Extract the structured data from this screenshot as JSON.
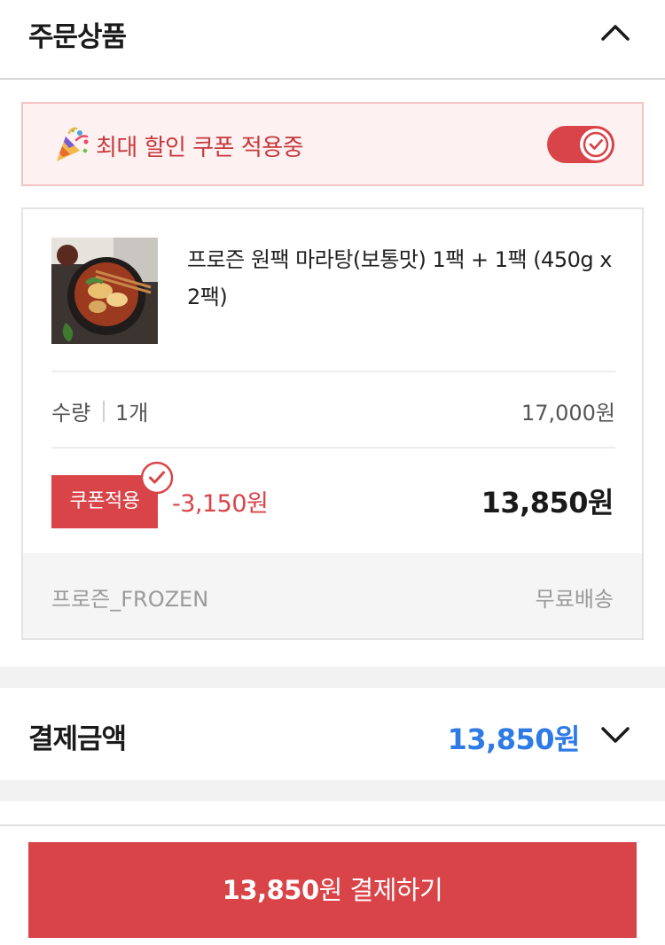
{
  "header": {
    "title": "주문상품",
    "collapse_icon": "chevron-up-icon"
  },
  "coupon_banner": {
    "icon": "party-popper-icon",
    "text": "최대 할인 쿠폰 적용중",
    "toggle_on": true,
    "accent_color": "#d94448"
  },
  "product": {
    "name": "프로즌 원팩 마라탕(보통맛) 1팩 + 1팩 (450g x 2팩)",
    "quantity_label": "수량",
    "quantity_value": "1개",
    "original_price": "17,000원",
    "coupon_badge": "쿠폰적용",
    "discount": "-3,150원",
    "final_price": "13,850원",
    "seller": "프로즌_FROZEN",
    "shipping": "무료배송"
  },
  "payment": {
    "label": "결제금액",
    "amount": "13,850원",
    "amount_color": "#2f7be6",
    "expand_icon": "chevron-down-icon"
  },
  "checkout_button": {
    "amount": "13,850",
    "suffix": "원 결제하기"
  }
}
